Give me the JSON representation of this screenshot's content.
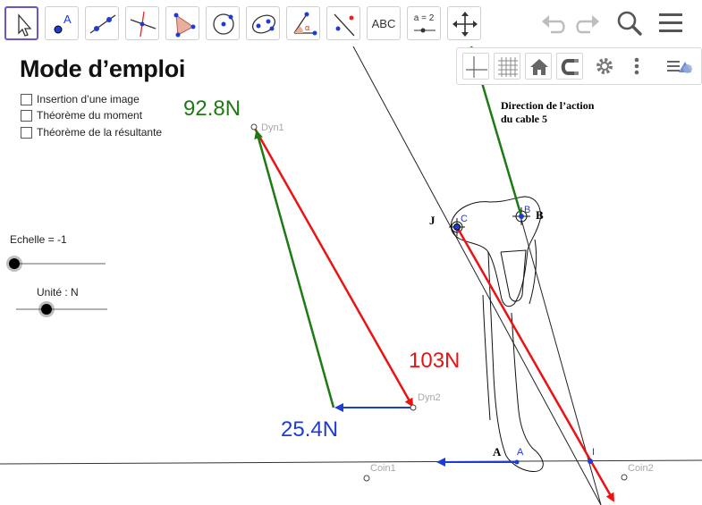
{
  "toolbar": {
    "tools": [
      {
        "name": "move-tool",
        "active": true
      },
      {
        "name": "point-tool"
      },
      {
        "name": "line-tool"
      },
      {
        "name": "perpendicular-line-tool"
      },
      {
        "name": "polygon-tool"
      },
      {
        "name": "circle-tool"
      },
      {
        "name": "ellipse-tool"
      },
      {
        "name": "angle-tool"
      },
      {
        "name": "reflect-tool"
      },
      {
        "name": "text-tool",
        "label": "ABC"
      },
      {
        "name": "slider-tool",
        "label": "a = 2"
      },
      {
        "name": "move-graphics-view-tool"
      }
    ],
    "right_icons": [
      "undo-icon",
      "redo-icon",
      "search-icon",
      "menu-icon"
    ]
  },
  "stylebar": {
    "icons": [
      "axes-icon",
      "grid-icon",
      "home-icon",
      "point-capturing-icon",
      "settings-icon",
      "more-icon",
      "toggle-stylebar-icon"
    ]
  },
  "panel": {
    "title": "Mode d’emploi",
    "checkboxes": [
      {
        "label": "Insertion d’une image",
        "checked": false
      },
      {
        "label": "Théorème du moment",
        "checked": false
      },
      {
        "label": "Théorème de la résultante",
        "checked": false
      }
    ],
    "slider_echelle_label": "Echelle = -1",
    "slider_unite_label": "Unité : N"
  },
  "drawing": {
    "force_labels": {
      "green": "92.8N",
      "red": "103N",
      "blue": "25.4N"
    },
    "points": {
      "dyn1": "Dyn1",
      "dyn2": "Dyn2",
      "coin1": "Coin1",
      "coin2": "Coin2",
      "b": "B",
      "c": "C",
      "a": "A",
      "i": "I"
    },
    "image_labels": {
      "direction": "Direction de l’action",
      "cable": "du cable 5",
      "j": "J",
      "b": "B",
      "a": "A"
    }
  },
  "colors": {
    "accent": "#6557d2",
    "green": "#1e7a14",
    "red": "#ee1111",
    "blue": "#1f3bd6",
    "label_grey": "#a8a8a8"
  }
}
